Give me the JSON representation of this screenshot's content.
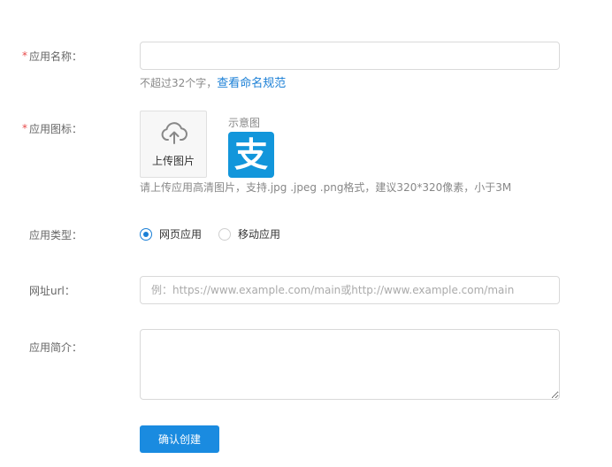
{
  "form": {
    "app_name": {
      "label": "应用名称：",
      "required_mark": "*",
      "value": "",
      "placeholder": "",
      "hint": "不超过32个字，",
      "hint_link": "查看命名规范"
    },
    "app_icon": {
      "label": "应用图标：",
      "required_mark": "*",
      "upload_label": "上传图片",
      "upload_icon": "cloud-upload-icon",
      "sample_label": "示意图",
      "sample_logo_char": "支",
      "sample_logo_color": "#1296db",
      "hint": "请上传应用高清图片，支持.jpg .jpeg .png格式，建议320*320像素，小于3M"
    },
    "app_type": {
      "label": "应用类型：",
      "options": [
        {
          "label": "网页应用",
          "checked": true
        },
        {
          "label": "移动应用",
          "checked": false
        }
      ]
    },
    "url": {
      "label": "网址url：",
      "value": "",
      "placeholder": "例：https://www.example.com/main或http://www.example.com/main"
    },
    "description": {
      "label": "应用简介：",
      "value": ""
    },
    "submit_label": "确认创建"
  },
  "colors": {
    "accent": "#1a8be0",
    "link": "#1a7fd6",
    "required": "#e84b4b"
  }
}
